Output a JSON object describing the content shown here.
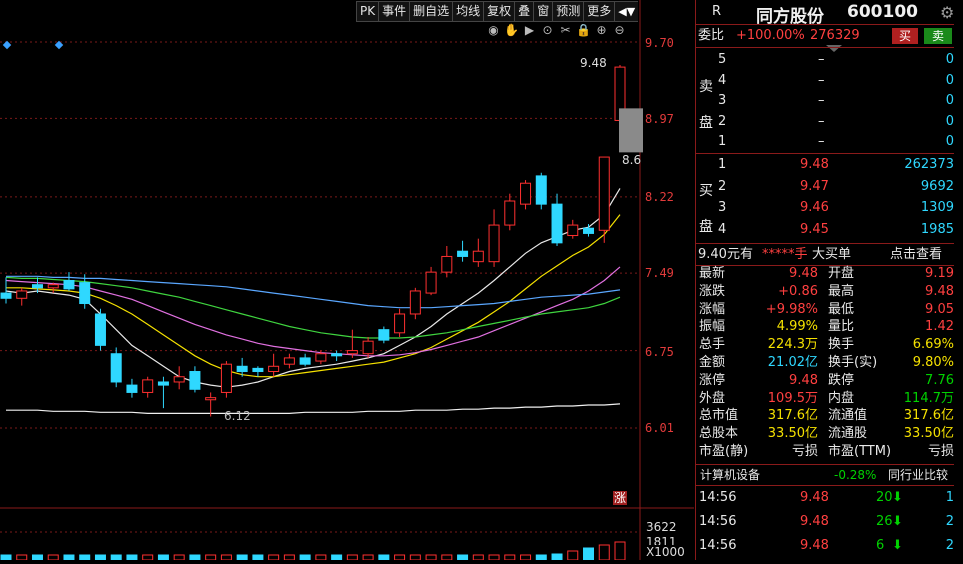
{
  "toolbar": {
    "items": [
      "PK",
      "事件",
      "删自选",
      "均线",
      "复权",
      "叠",
      "窗",
      "预测",
      "更多"
    ],
    "arrow_label": "◀▼"
  },
  "chart_tools": [
    "eye-icon",
    "hand-icon",
    "play-icon",
    "crosshair-icon",
    "scissors-icon",
    "lock-icon",
    "zoom-in-icon",
    "zoom-out-icon"
  ],
  "y_axis_labels": [
    "9.70",
    "8.97",
    "8.22",
    "7.49",
    "6.75",
    "6.01"
  ],
  "annotations": {
    "high": "9.48",
    "last": "8.6",
    "low": "6.12",
    "rise_marker": "涨"
  },
  "volume": {
    "label": "3622",
    "bottom": "1811",
    "unit": "X1000"
  },
  "colors": {
    "up": "#ff3030",
    "down": "#2fd8ff",
    "grid": "#8a1a1a",
    "accent_red": "#ff4040",
    "accent_green": "#00d200"
  },
  "chart_data": {
    "type": "candlestick",
    "ylim": [
      6.01,
      9.7
    ],
    "y_ticks": [
      9.7,
      8.97,
      8.22,
      7.49,
      6.75,
      6.01
    ],
    "candles": [
      {
        "o": 7.3,
        "h": 7.45,
        "l": 7.2,
        "c": 7.25,
        "dir": "down"
      },
      {
        "o": 7.25,
        "h": 7.35,
        "l": 7.18,
        "c": 7.32,
        "dir": "up"
      },
      {
        "o": 7.38,
        "h": 7.45,
        "l": 7.3,
        "c": 7.35,
        "dir": "down"
      },
      {
        "o": 7.35,
        "h": 7.4,
        "l": 7.3,
        "c": 7.38,
        "dir": "up"
      },
      {
        "o": 7.42,
        "h": 7.5,
        "l": 7.32,
        "c": 7.34,
        "dir": "down"
      },
      {
        "o": 7.4,
        "h": 7.48,
        "l": 7.15,
        "c": 7.2,
        "dir": "down"
      },
      {
        "o": 7.1,
        "h": 7.15,
        "l": 6.75,
        "c": 6.8,
        "dir": "down"
      },
      {
        "o": 6.72,
        "h": 6.78,
        "l": 6.4,
        "c": 6.45,
        "dir": "down"
      },
      {
        "o": 6.42,
        "h": 6.48,
        "l": 6.3,
        "c": 6.35,
        "dir": "down"
      },
      {
        "o": 6.35,
        "h": 6.5,
        "l": 6.3,
        "c": 6.47,
        "dir": "up"
      },
      {
        "o": 6.45,
        "h": 6.5,
        "l": 6.2,
        "c": 6.42,
        "dir": "down"
      },
      {
        "o": 6.45,
        "h": 6.6,
        "l": 6.38,
        "c": 6.5,
        "dir": "up"
      },
      {
        "o": 6.55,
        "h": 6.6,
        "l": 6.35,
        "c": 6.38,
        "dir": "down"
      },
      {
        "o": 6.3,
        "h": 6.35,
        "l": 6.12,
        "c": 6.28,
        "dir": "up"
      },
      {
        "o": 6.35,
        "h": 6.65,
        "l": 6.3,
        "c": 6.62,
        "dir": "up"
      },
      {
        "o": 6.6,
        "h": 6.68,
        "l": 6.5,
        "c": 6.55,
        "dir": "down"
      },
      {
        "o": 6.55,
        "h": 6.6,
        "l": 6.5,
        "c": 6.58,
        "dir": "down"
      },
      {
        "o": 6.55,
        "h": 6.72,
        "l": 6.5,
        "c": 6.6,
        "dir": "up"
      },
      {
        "o": 6.62,
        "h": 6.72,
        "l": 6.58,
        "c": 6.68,
        "dir": "up"
      },
      {
        "o": 6.68,
        "h": 6.72,
        "l": 6.6,
        "c": 6.62,
        "dir": "down"
      },
      {
        "o": 6.65,
        "h": 6.75,
        "l": 6.62,
        "c": 6.72,
        "dir": "up"
      },
      {
        "o": 6.72,
        "h": 6.75,
        "l": 6.65,
        "c": 6.7,
        "dir": "down"
      },
      {
        "o": 6.72,
        "h": 6.95,
        "l": 6.68,
        "c": 6.75,
        "dir": "up"
      },
      {
        "o": 6.72,
        "h": 6.88,
        "l": 6.68,
        "c": 6.84,
        "dir": "up"
      },
      {
        "o": 6.95,
        "h": 6.98,
        "l": 6.82,
        "c": 6.85,
        "dir": "down"
      },
      {
        "o": 6.92,
        "h": 7.15,
        "l": 6.88,
        "c": 7.1,
        "dir": "up"
      },
      {
        "o": 7.1,
        "h": 7.35,
        "l": 7.05,
        "c": 7.32,
        "dir": "up"
      },
      {
        "o": 7.3,
        "h": 7.55,
        "l": 7.28,
        "c": 7.5,
        "dir": "up"
      },
      {
        "o": 7.5,
        "h": 7.75,
        "l": 7.45,
        "c": 7.65,
        "dir": "up"
      },
      {
        "o": 7.7,
        "h": 7.8,
        "l": 7.6,
        "c": 7.65,
        "dir": "down"
      },
      {
        "o": 7.6,
        "h": 7.82,
        "l": 7.55,
        "c": 7.7,
        "dir": "up"
      },
      {
        "o": 7.6,
        "h": 8.1,
        "l": 7.55,
        "c": 7.95,
        "dir": "up"
      },
      {
        "o": 7.95,
        "h": 8.25,
        "l": 7.9,
        "c": 8.18,
        "dir": "up"
      },
      {
        "o": 8.15,
        "h": 8.38,
        "l": 8.1,
        "c": 8.35,
        "dir": "up"
      },
      {
        "o": 8.42,
        "h": 8.45,
        "l": 8.1,
        "c": 8.15,
        "dir": "down"
      },
      {
        "o": 8.15,
        "h": 8.25,
        "l": 7.75,
        "c": 7.78,
        "dir": "down"
      },
      {
        "o": 7.85,
        "h": 8.0,
        "l": 7.82,
        "c": 7.95,
        "dir": "up"
      },
      {
        "o": 7.92,
        "h": 7.96,
        "l": 7.84,
        "c": 7.87,
        "dir": "down"
      },
      {
        "o": 7.9,
        "h": 8.6,
        "l": 7.78,
        "c": 8.6,
        "dir": "up"
      },
      {
        "o": 8.95,
        "h": 9.48,
        "l": 8.95,
        "c": 9.46,
        "dir": "up"
      }
    ],
    "moving_averages": [
      {
        "color": "#e8e8e8",
        "values": [
          7.32,
          7.3,
          7.32,
          7.3,
          7.28,
          7.24,
          7.1,
          6.95,
          6.8,
          6.7,
          6.6,
          6.5,
          6.45,
          6.42,
          6.4,
          6.42,
          6.45,
          6.5,
          6.55,
          6.58,
          6.6,
          6.62,
          6.65,
          6.68,
          6.72,
          6.8,
          6.88,
          6.98,
          7.1,
          7.2,
          7.3,
          7.42,
          7.55,
          7.68,
          7.78,
          7.84,
          7.9,
          7.93,
          8.05,
          8.3
        ]
      },
      {
        "color": "#f5e100",
        "values": [
          7.35,
          7.35,
          7.34,
          7.33,
          7.32,
          7.3,
          7.25,
          7.18,
          7.1,
          7.0,
          6.9,
          6.8,
          6.7,
          6.62,
          6.56,
          6.52,
          6.5,
          6.5,
          6.52,
          6.54,
          6.56,
          6.58,
          6.6,
          6.62,
          6.64,
          6.68,
          6.72,
          6.78,
          6.86,
          6.94,
          7.02,
          7.12,
          7.22,
          7.34,
          7.46,
          7.56,
          7.66,
          7.74,
          7.86,
          8.05
        ]
      },
      {
        "color": "#e070e0",
        "values": [
          7.42,
          7.41,
          7.4,
          7.39,
          7.38,
          7.36,
          7.32,
          7.28,
          7.24,
          7.18,
          7.12,
          7.06,
          7.0,
          6.95,
          6.9,
          6.86,
          6.82,
          6.79,
          6.77,
          6.75,
          6.73,
          6.72,
          6.71,
          6.7,
          6.7,
          6.71,
          6.73,
          6.76,
          6.8,
          6.84,
          6.88,
          6.94,
          7.0,
          7.06,
          7.12,
          7.18,
          7.24,
          7.32,
          7.42,
          7.55
        ]
      },
      {
        "color": "#3fd43f",
        "values": [
          7.45,
          7.44,
          7.44,
          7.43,
          7.42,
          7.41,
          7.39,
          7.37,
          7.35,
          7.32,
          7.29,
          7.26,
          7.22,
          7.18,
          7.14,
          7.1,
          7.06,
          7.02,
          6.98,
          6.95,
          6.92,
          6.9,
          6.88,
          6.87,
          6.87,
          6.87,
          6.88,
          6.9,
          6.92,
          6.95,
          6.98,
          7.01,
          7.04,
          7.07,
          7.1,
          7.12,
          7.14,
          7.16,
          7.2,
          7.26
        ]
      },
      {
        "color": "#5aa7ff",
        "values": [
          7.46,
          7.46,
          7.46,
          7.45,
          7.45,
          7.44,
          7.44,
          7.43,
          7.42,
          7.41,
          7.4,
          7.39,
          7.38,
          7.37,
          7.36,
          7.34,
          7.32,
          7.3,
          7.28,
          7.26,
          7.24,
          7.22,
          7.2,
          7.18,
          7.17,
          7.16,
          7.16,
          7.16,
          7.17,
          7.18,
          7.19,
          7.2,
          7.22,
          7.24,
          7.26,
          7.27,
          7.28,
          7.29,
          7.31,
          7.33
        ]
      },
      {
        "color": "#f0f0f0",
        "values": [
          6.18,
          6.18,
          6.18,
          6.17,
          6.17,
          6.17,
          6.16,
          6.16,
          6.16,
          6.15,
          6.15,
          6.15,
          6.15,
          6.15,
          6.15,
          6.15,
          6.15,
          6.15,
          6.15,
          6.16,
          6.16,
          6.16,
          6.16,
          6.17,
          6.17,
          6.17,
          6.18,
          6.18,
          6.18,
          6.19,
          6.19,
          6.2,
          6.2,
          6.21,
          6.21,
          6.22,
          6.22,
          6.23,
          6.23,
          6.24
        ]
      }
    ]
  },
  "panel": {
    "flag": "R",
    "stock_name": "同方股份",
    "stock_code": "600100",
    "weibi": {
      "label": "委比",
      "value": "+100.00%",
      "diff": "276329",
      "sell_btn": "买",
      "buy_btn": "卖"
    },
    "sell_label_1": "卖",
    "sell_label_2": "盘",
    "sells": [
      {
        "n": "5",
        "price": "–",
        "vol": "0"
      },
      {
        "n": "4",
        "price": "–",
        "vol": "0"
      },
      {
        "n": "3",
        "price": "–",
        "vol": "0"
      },
      {
        "n": "2",
        "price": "–",
        "vol": "0"
      },
      {
        "n": "1",
        "price": "–",
        "vol": "0"
      }
    ],
    "buy_label_1": "买",
    "buy_label_2": "盘",
    "buys": [
      {
        "n": "1",
        "price": "9.48",
        "vol": "262373"
      },
      {
        "n": "2",
        "price": "9.47",
        "vol": "9692"
      },
      {
        "n": "3",
        "price": "9.46",
        "vol": "1309"
      },
      {
        "n": "4",
        "price": "9.45",
        "vol": "1985"
      }
    ],
    "bigorder": {
      "price": "9.40元有",
      "mask": "*****手",
      "label": "大买单",
      "link": "点击查看"
    },
    "stats": [
      {
        "l1": "最新",
        "v1": "9.48",
        "c1": "red",
        "l2": "开盘",
        "v2": "9.19",
        "c2": "red"
      },
      {
        "l1": "涨跌",
        "v1": "+0.86",
        "c1": "red",
        "l2": "最高",
        "v2": "9.48",
        "c2": "red"
      },
      {
        "l1": "涨幅",
        "v1": "+9.98%",
        "c1": "red",
        "l2": "最低",
        "v2": "9.05",
        "c2": "red"
      },
      {
        "l1": "振幅",
        "v1": "4.99%",
        "c1": "yellow",
        "l2": "量比",
        "v2": "1.42",
        "c2": "red"
      },
      {
        "l1": "总手",
        "v1": "224.3万",
        "c1": "yellow",
        "l2": "换手",
        "v2": "6.69%",
        "c2": "yellow"
      },
      {
        "l1": "金额",
        "v1": "21.02亿",
        "c1": "cyan",
        "l2": "换手(实)",
        "v2": "9.80%",
        "c2": "yellow"
      },
      {
        "l1": "涨停",
        "v1": "9.48",
        "c1": "red",
        "l2": "跌停",
        "v2": "7.76",
        "c2": "green"
      },
      {
        "l1": "外盘",
        "v1": "109.5万",
        "c1": "red",
        "l2": "内盘",
        "v2": "114.7万",
        "c2": "green"
      },
      {
        "l1": "总市值",
        "v1": "317.6亿",
        "c1": "yellow",
        "l2": "流通值",
        "v2": "317.6亿",
        "c2": "yellow"
      },
      {
        "l1": "总股本",
        "v1": "33.50亿",
        "c1": "yellow",
        "l2": "流通股",
        "v2": "33.50亿",
        "c2": "yellow"
      },
      {
        "l1": "市盈(静)",
        "v1": "亏损",
        "c1": "white",
        "l2": "市盈(TTM)",
        "v2": "亏损",
        "c2": "white"
      }
    ],
    "industry": {
      "name": "计算机设备",
      "change": "-0.28%",
      "compare": "同行业比较"
    },
    "ticks": [
      {
        "time": "14:56",
        "price": "9.48",
        "vol": "20",
        "n": "1"
      },
      {
        "time": "14:56",
        "price": "9.48",
        "vol": "26",
        "n": "2"
      },
      {
        "time": "14:56",
        "price": "9.48",
        "vol": "6",
        "n": "2"
      }
    ]
  }
}
